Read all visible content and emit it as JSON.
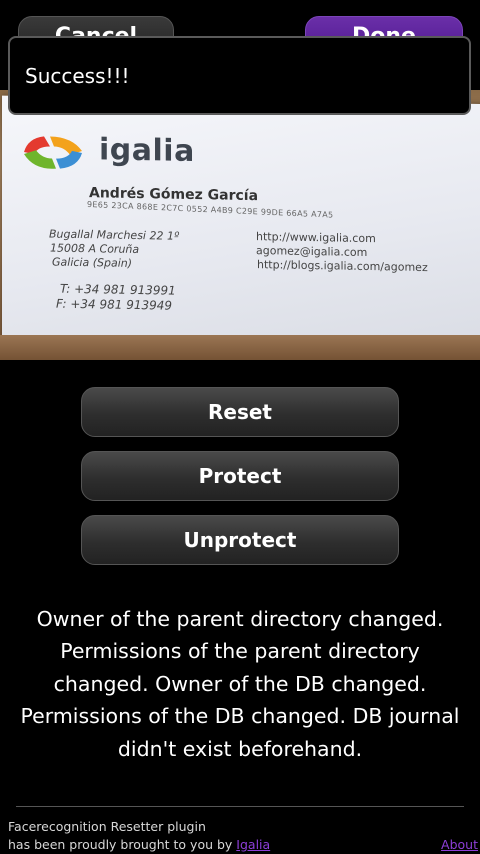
{
  "header": {
    "cancel_label": "Cancel",
    "done_label": "Done"
  },
  "banner": {
    "message": "Success!!!"
  },
  "photo": {
    "logo_text": "igalia",
    "name": "Andrés Gómez García",
    "fingerprint": "9E65 23CA 868E 2C7C 0552 A4B9 C29E 99DE 66A5 A7A5",
    "address_lines": [
      "Bugallal Marchesi 22 1º",
      "15008 A Coruña",
      "Galicia (Spain)"
    ],
    "contact_lines": [
      "http://www.igalia.com",
      "agomez@igalia.com",
      "http://blogs.igalia.com/agomez"
    ],
    "phone_lines": [
      "T: +34 981 913991",
      "F: +34 981 913949"
    ]
  },
  "actions": {
    "reset_label": "Reset",
    "protect_label": "Protect",
    "unprotect_label": "Unprotect"
  },
  "status_text": "Owner of the parent directory changed. Permissions of the parent directory changed. Owner of the DB changed. Permissions of the DB changed. DB journal didn't exist beforehand.",
  "footer": {
    "line1": "Facerecognition Resetter plugin",
    "line2_prefix": "has been proudly brought to you by ",
    "author_link": "Igalia",
    "about_link": "About"
  },
  "colors": {
    "accent": "#6a2fa8",
    "link": "#8d3ed8",
    "background": "#000000"
  }
}
